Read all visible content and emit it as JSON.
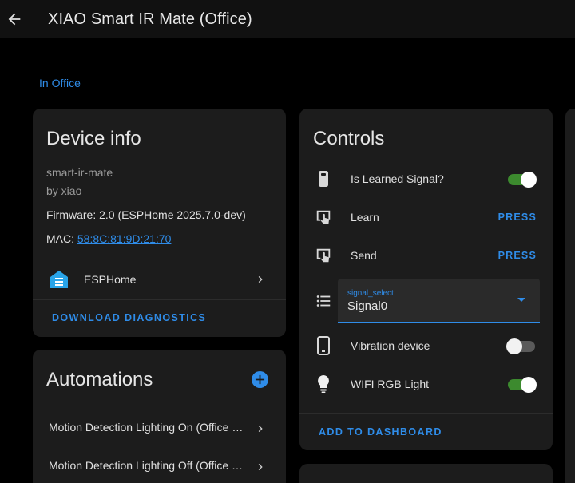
{
  "header": {
    "title": "XIAO Smart IR Mate (Office)"
  },
  "area_link": "In Office",
  "device_info": {
    "title": "Device info",
    "model": "smart-ir-mate",
    "manufacturer": "by xiao",
    "firmware": "Firmware: 2.0 (ESPHome 2025.7.0-dev)",
    "mac_label": "MAC: ",
    "mac_value": "58:8C:81:9D:21:70",
    "integration": "ESPHome",
    "download_label": "DOWNLOAD DIAGNOSTICS"
  },
  "automations": {
    "title": "Automations",
    "items": [
      {
        "label": "Motion Detection Lighting On (Office D..."
      },
      {
        "label": "Motion Detection Lighting Off (Office D..."
      }
    ]
  },
  "controls": {
    "title": "Controls",
    "learned_signal": {
      "label": "Is Learned Signal?",
      "state": "on"
    },
    "learn": {
      "label": "Learn",
      "action": "PRESS"
    },
    "send": {
      "label": "Send",
      "action": "PRESS"
    },
    "signal_select": {
      "label": "signal_select",
      "value": "Signal0"
    },
    "vibration": {
      "label": "Vibration device",
      "state": "off"
    },
    "rgb_light": {
      "label": "WIFI RGB Light",
      "state": "on"
    },
    "add_to_dashboard": "ADD TO DASHBOARD"
  },
  "colors": {
    "accent": "#2f8ce8",
    "toggle_on": "#3c8a2e",
    "card": "#1c1c1c",
    "background": "#000000"
  }
}
